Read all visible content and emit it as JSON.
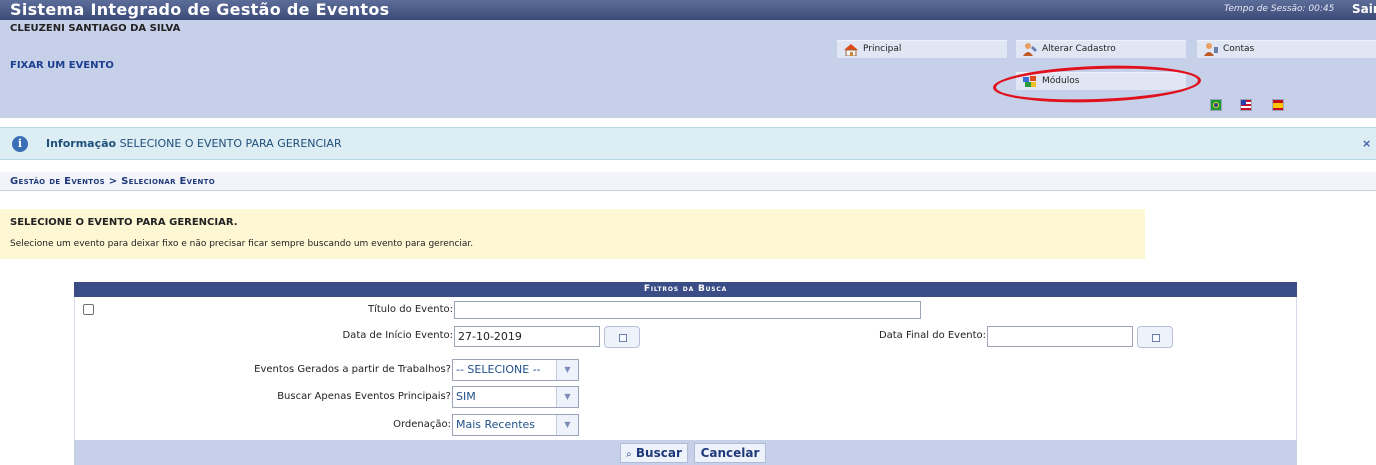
{
  "topbar": {
    "app_title": "Sistema Integrado de Gestão de Eventos",
    "session": "Tempo de Sessão: 00:45",
    "logout": "Sair"
  },
  "header": {
    "user_name": "CLEUZENI SANTIAGO DA SILVA",
    "fixed_event_link": "FIXAR UM EVENTO",
    "menu": [
      {
        "label": "Principal",
        "icon": "home-icon"
      },
      {
        "label": "Alterar Cadastro",
        "icon": "user-edit-icon"
      },
      {
        "label": "Contas",
        "icon": "user-accounts-icon"
      },
      {
        "label": "Módulos",
        "icon": "modules-icon"
      }
    ],
    "languages": [
      {
        "icon": "flag-brazil-icon"
      },
      {
        "icon": "flag-usa-icon"
      },
      {
        "icon": "flag-spain-icon"
      }
    ],
    "highlight_color": "#e0101c"
  },
  "info": {
    "label": "Informação",
    "message": "SELECIONE O EVENTO PARA GERENCIAR",
    "close": "×"
  },
  "breadcrumb": {
    "text": "Gestão de Eventos > Selecionar Evento"
  },
  "notice": {
    "title": "SELECIONE O EVENTO PARA GERENCIAR.",
    "text": "Selecione um evento para deixar fixo e não precisar ficar sempre buscando um evento para gerenciar."
  },
  "filters": {
    "title": "Filtros da Busca",
    "event_title": {
      "label": "Título do Evento:",
      "value": ""
    },
    "start_date": {
      "label": "Data de Início Evento:",
      "value": "27-10-2019"
    },
    "end_date": {
      "label": "Data Final do Evento:",
      "value": ""
    },
    "generated_from_works": {
      "label": "Eventos Gerados a partir de Trabalhos?",
      "value": "-- SELECIONE --"
    },
    "only_main": {
      "label": "Buscar Apenas Eventos Principais?",
      "value": "SIM"
    },
    "ordering": {
      "label": "Ordenação:",
      "value": "Mais Recentes"
    },
    "search_button": "Buscar",
    "cancel_button": "Cancelar"
  }
}
